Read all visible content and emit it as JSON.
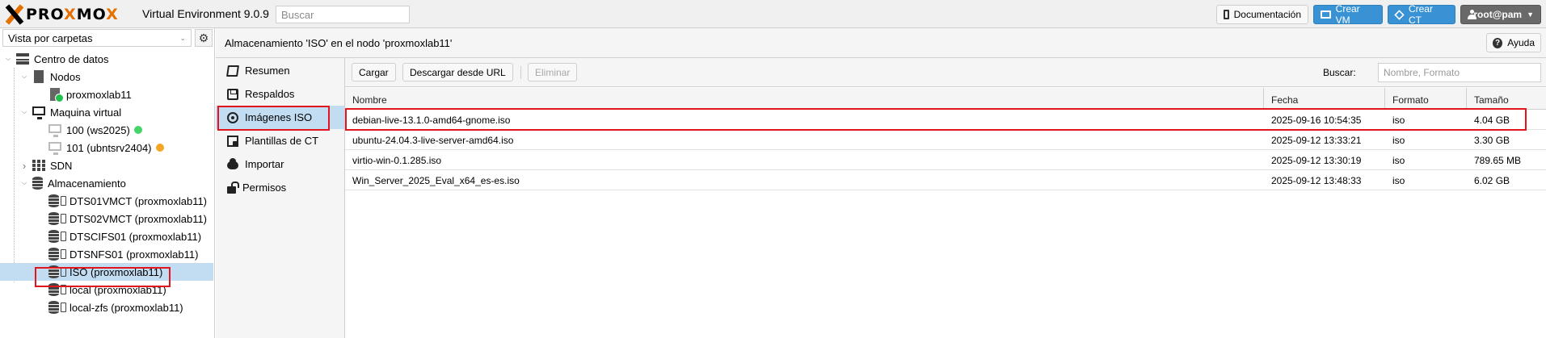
{
  "header": {
    "brand_part1": "PRO",
    "brand_x": "X",
    "brand_part2": "MO",
    "brand_part3": "X",
    "version": "Virtual Environment 9.0.9",
    "search_placeholder": "Buscar",
    "doc_label": "Documentación",
    "create_vm_label": "Crear VM",
    "create_ct_label": "Crear CT",
    "user_label": "root@pam"
  },
  "sidebar": {
    "view_select": "Vista por carpetas",
    "tree": [
      {
        "label": "Centro de datos",
        "level": 0,
        "icon": "datacenter-icon",
        "expanded": true
      },
      {
        "label": "Nodos",
        "level": 1,
        "icon": "server-icon",
        "expanded": true
      },
      {
        "label": "proxmoxlab11",
        "level": 2,
        "icon": "node-online-icon"
      },
      {
        "label": "Maquina virtual",
        "level": 1,
        "icon": "monitor-icon",
        "expanded": true
      },
      {
        "label": "100 (ws2025)",
        "level": 2,
        "icon": "vm-icon",
        "status": "green"
      },
      {
        "label": "101 (ubntsrv2404)",
        "level": 2,
        "icon": "vm-icon",
        "status": "orange"
      },
      {
        "label": "SDN",
        "level": 1,
        "icon": "sdn-grid-icon",
        "expanded": false
      },
      {
        "label": "Almacenamiento",
        "level": 1,
        "icon": "database-icon",
        "expanded": true
      },
      {
        "label": "DTS01VMCT (proxmoxlab11)",
        "level": 2,
        "icon": "storage-icon"
      },
      {
        "label": "DTS02VMCT (proxmoxlab11)",
        "level": 2,
        "icon": "storage-icon"
      },
      {
        "label": "DTSCIFS01 (proxmoxlab11)",
        "level": 2,
        "icon": "storage-icon"
      },
      {
        "label": "DTSNFS01 (proxmoxlab11)",
        "level": 2,
        "icon": "storage-icon"
      },
      {
        "label": "ISO (proxmoxlab11)",
        "level": 2,
        "icon": "storage-icon",
        "selected": true
      },
      {
        "label": "local (proxmoxlab11)",
        "level": 2,
        "icon": "storage-icon"
      },
      {
        "label": "local-zfs (proxmoxlab11)",
        "level": 2,
        "icon": "storage-icon"
      }
    ]
  },
  "panel": {
    "title": "Almacenamiento 'ISO' en el nodo 'proxmoxlab11'",
    "help_label": "Ayuda"
  },
  "subnav": [
    {
      "label": "Resumen",
      "icon": "book-icon"
    },
    {
      "label": "Respaldos",
      "icon": "floppy-icon"
    },
    {
      "label": "Imágenes ISO",
      "icon": "disc-icon",
      "selected": true
    },
    {
      "label": "Plantillas de CT",
      "icon": "template-icon"
    },
    {
      "label": "Importar",
      "icon": "cloud-upload-icon"
    },
    {
      "label": "Permisos",
      "icon": "unlock-icon"
    }
  ],
  "toolbar": {
    "upload_label": "Cargar",
    "download_url_label": "Descargar desde URL",
    "remove_label": "Eliminar",
    "search_label": "Buscar:",
    "search_placeholder": "Nombre, Formato"
  },
  "table": {
    "columns": [
      "Nombre",
      "Fecha",
      "Formato",
      "Tamaño"
    ],
    "rows": [
      [
        "debian-live-13.1.0-amd64-gnome.iso",
        "2025-09-16 10:54:35",
        "iso",
        "4.04 GB"
      ],
      [
        "ubuntu-24.04.3-live-server-amd64.iso",
        "2025-09-12 13:33:21",
        "iso",
        "3.30 GB"
      ],
      [
        "virtio-win-0.1.285.iso",
        "2025-09-12 13:30:19",
        "iso",
        "789.65 MB"
      ],
      [
        "Win_Server_2025_Eval_x64_es-es.iso",
        "2025-09-12 13:48:33",
        "iso",
        "6.02 GB"
      ]
    ]
  },
  "colors": {
    "accent_orange": "#e57000",
    "selection_blue": "#c2ddf2",
    "button_blue": "#3892d4",
    "highlight_red": "#e0151d"
  }
}
